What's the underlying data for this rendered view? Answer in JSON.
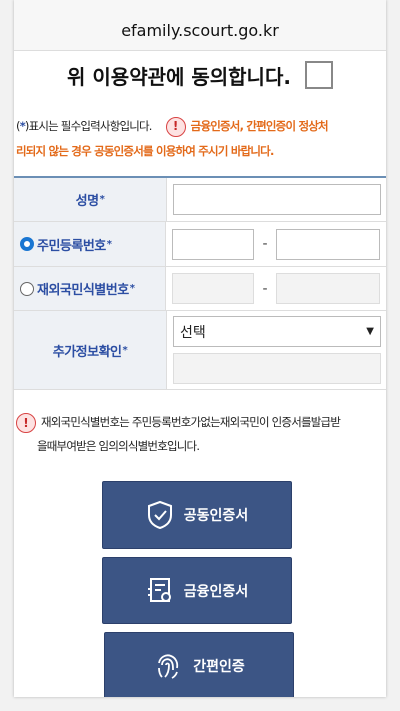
{
  "browser": {
    "url": "efamily.scourt.go.kr"
  },
  "agreement": {
    "label": "위 이용약관에 동의합니다."
  },
  "notice": {
    "star_symbol": "*",
    "required_text": ")표시는 필수입력사항입니다.",
    "warning_line1": "금융인증서, 간편인증이 정상처",
    "warning_line2": "리되지 않는 경우 공동인증서를 이용하여 주시기 바랍니다."
  },
  "form": {
    "name_label": "성명",
    "resident_label": "주민등록번호",
    "foreigner_label": "재외국민식별번호",
    "extra_label": "추가정보확인",
    "required_mark": "*",
    "dash": "-",
    "select_value": "선택"
  },
  "foreigner_notice": {
    "line1": "재외국민식별번호는 주민등록번호가없는재외국민이 인증서를발급받",
    "line2": "을때부여받은 임의의식별번호입니다."
  },
  "buttons": {
    "joint_cert": "공동인증서",
    "financial_cert": "금융인증서",
    "simple_auth": "간편인증"
  },
  "colors": {
    "accent": "#2c4ea3",
    "warning": "#e36a1a",
    "button": "#3c5585",
    "radio_selected": "#1976d2"
  },
  "icons": [
    "warning-icon",
    "shield-check-icon",
    "certificate-icon",
    "fingerprint-icon",
    "dropdown-arrow-icon"
  ]
}
